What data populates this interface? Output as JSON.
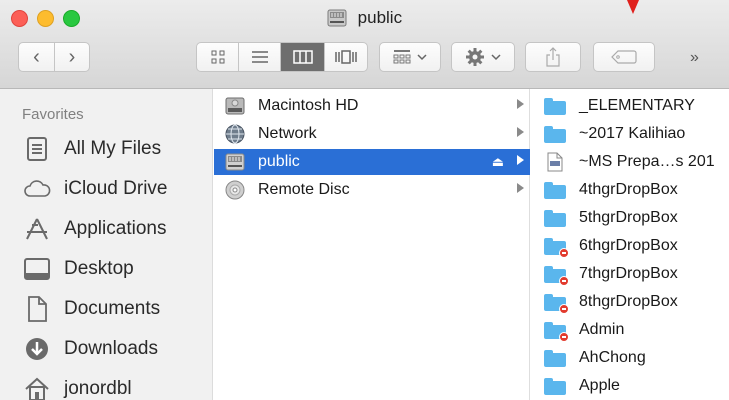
{
  "window": {
    "title": "public"
  },
  "toolbar": {
    "overflow_label": "»"
  },
  "sidebar": {
    "header": "Favorites",
    "items": [
      {
        "label": "All My Files",
        "icon": "all-files-icon"
      },
      {
        "label": "iCloud Drive",
        "icon": "cloud-icon"
      },
      {
        "label": "Applications",
        "icon": "applications-icon"
      },
      {
        "label": "Desktop",
        "icon": "desktop-icon"
      },
      {
        "label": "Documents",
        "icon": "documents-icon"
      },
      {
        "label": "Downloads",
        "icon": "downloads-icon"
      },
      {
        "label": "jonordbl",
        "icon": "home-icon"
      }
    ]
  },
  "column1": {
    "rows": [
      {
        "label": "Macintosh HD",
        "icon": "hard-drive-icon"
      },
      {
        "label": "Network",
        "icon": "network-icon"
      },
      {
        "label": "public",
        "icon": "server-drive-icon",
        "selected": true
      },
      {
        "label": "Remote Disc",
        "icon": "disc-icon"
      }
    ],
    "eject_glyph": "⏏"
  },
  "column2": {
    "rows": [
      {
        "label": "_ELEMENTARY",
        "icon": "folder-icon"
      },
      {
        "label": "~2017 Kalihiao",
        "icon": "folder-icon"
      },
      {
        "label": "~MS Prepa…s 201",
        "icon": "document-icon"
      },
      {
        "label": "4thgrDropBox",
        "icon": "folder-icon"
      },
      {
        "label": "5thgrDropBox",
        "icon": "folder-icon"
      },
      {
        "label": "6thgrDropBox",
        "icon": "restricted-folder-icon"
      },
      {
        "label": "7thgrDropBox",
        "icon": "restricted-folder-icon"
      },
      {
        "label": "8thgrDropBox",
        "icon": "restricted-folder-icon"
      },
      {
        "label": "Admin",
        "icon": "restricted-folder-icon"
      },
      {
        "label": "AhChong",
        "icon": "folder-icon"
      },
      {
        "label": "Apple",
        "icon": "folder-icon"
      }
    ]
  },
  "colors": {
    "selection": "#2a6fd6",
    "folder": "#5ab6ed",
    "restricted_badge": "#e23b2e",
    "red_arrow": "#e0201c"
  }
}
